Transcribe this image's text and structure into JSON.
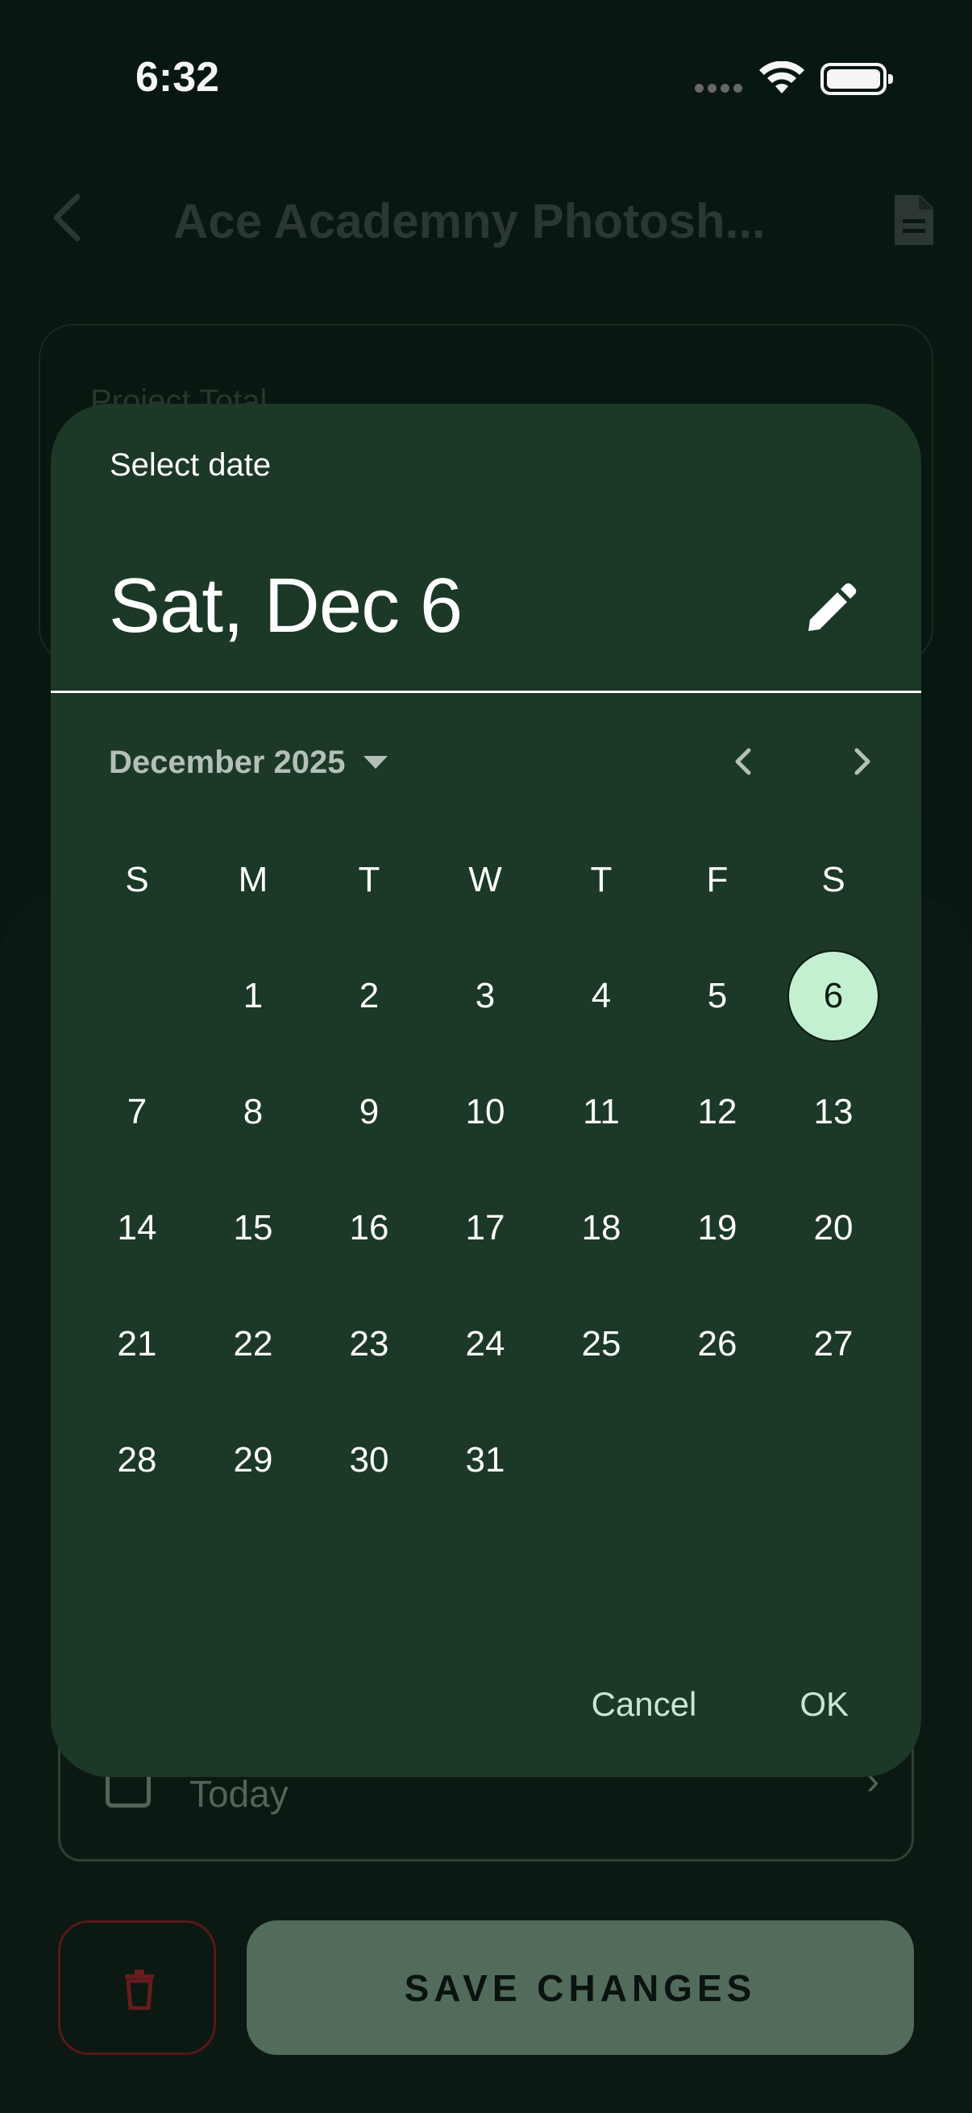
{
  "status_bar": {
    "time": "6:32"
  },
  "app_bar": {
    "title": "Ace Academny Photosh..."
  },
  "summary_card": {
    "label": "Project Total"
  },
  "form": {
    "date_value": "Today"
  },
  "actions": {
    "save_label": "SAVE CHANGES"
  },
  "date_picker": {
    "header_label": "Select date",
    "selected_date_text": "Sat, Dec 6",
    "month_year": "December 2025",
    "weekdays": [
      "S",
      "M",
      "T",
      "W",
      "T",
      "F",
      "S"
    ],
    "weeks": [
      [
        "",
        "1",
        "2",
        "3",
        "4",
        "5",
        "6"
      ],
      [
        "7",
        "8",
        "9",
        "10",
        "11",
        "12",
        "13"
      ],
      [
        "14",
        "15",
        "16",
        "17",
        "18",
        "19",
        "20"
      ],
      [
        "21",
        "22",
        "23",
        "24",
        "25",
        "26",
        "27"
      ],
      [
        "28",
        "29",
        "30",
        "31",
        "",
        "",
        ""
      ]
    ],
    "selected_day": "6",
    "cancel_label": "Cancel",
    "ok_label": "OK"
  },
  "colors": {
    "dialog_bg": "#1c3826",
    "selected_day_bg": "#c4f0d2",
    "save_button_bg": "#57705f",
    "delete_border": "#5c1a1a"
  },
  "icons": [
    "back-chevron-icon",
    "document-icon",
    "pencil-icon",
    "caret-down-icon",
    "chevron-left-icon",
    "chevron-right-icon",
    "trash-icon",
    "checkbox-icon",
    "wifi-icon",
    "battery-icon"
  ]
}
